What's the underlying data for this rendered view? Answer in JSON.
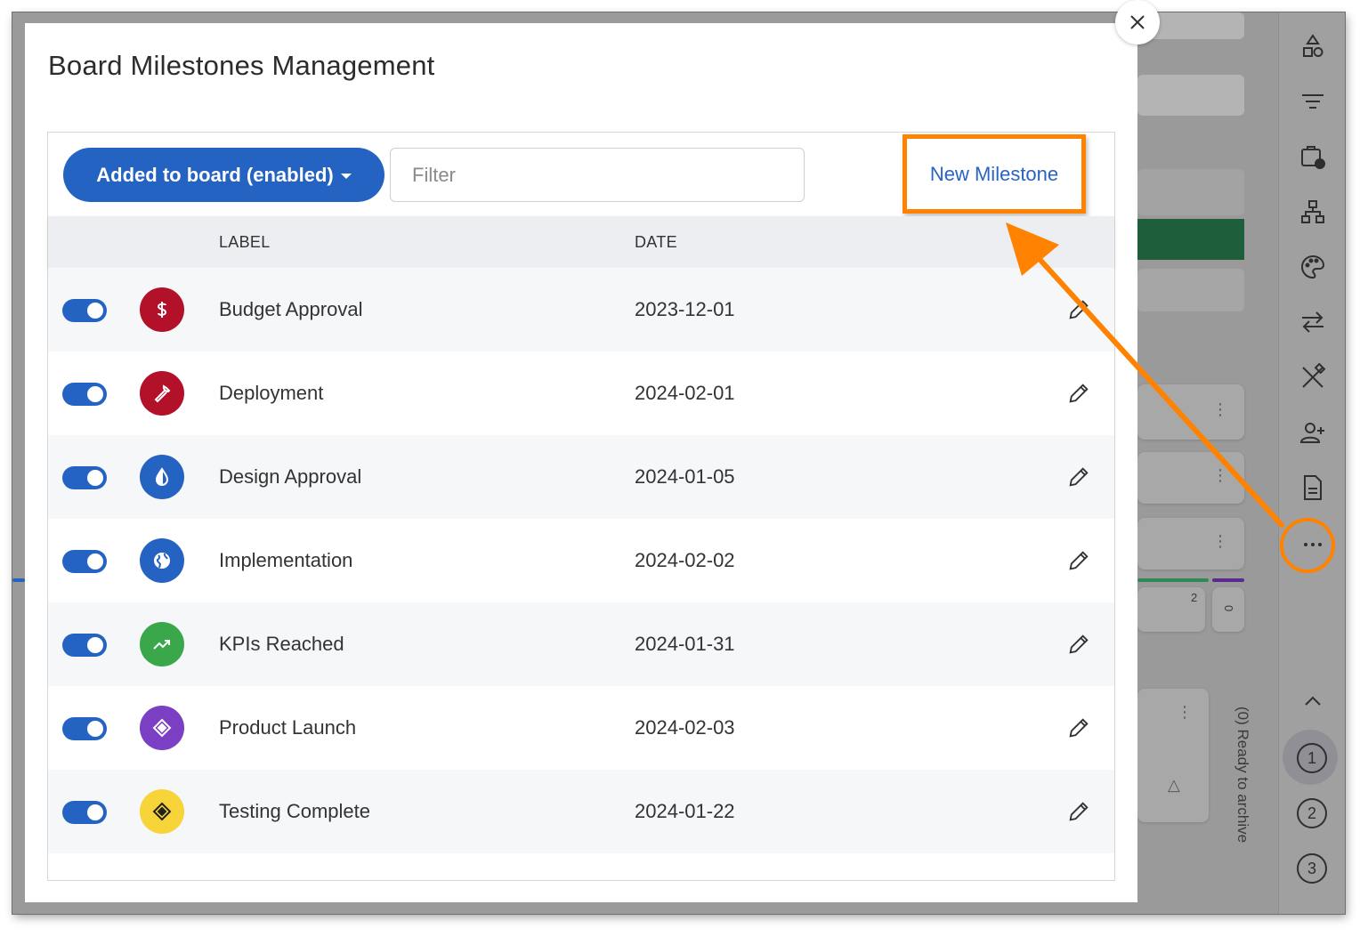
{
  "modal": {
    "title": "Board Milestones Management",
    "close_icon": "close-icon"
  },
  "toolbar": {
    "filter_dropdown_label": "Added to board (enabled)",
    "filter_placeholder": "Filter",
    "new_milestone_label": "New Milestone"
  },
  "table": {
    "columns": [
      "LABEL",
      "DATE"
    ],
    "rows": [
      {
        "label": "Budget Approval",
        "date": "2023-12-01",
        "enabled": true,
        "icon": "dollar-icon",
        "color": "#b3102a"
      },
      {
        "label": "Deployment",
        "date": "2024-02-01",
        "enabled": true,
        "icon": "wrench-icon",
        "color": "#b3102a"
      },
      {
        "label": "Design Approval",
        "date": "2024-01-05",
        "enabled": true,
        "icon": "contrast-drop-icon",
        "color": "#2563c3"
      },
      {
        "label": "Implementation",
        "date": "2024-02-02",
        "enabled": true,
        "icon": "globe-icon",
        "color": "#2563c3"
      },
      {
        "label": "KPIs Reached",
        "date": "2024-01-31",
        "enabled": true,
        "icon": "trending-up-icon",
        "color": "#3aa84a"
      },
      {
        "label": "Product Launch",
        "date": "2024-02-03",
        "enabled": true,
        "icon": "diamond-icon",
        "color": "#7b3fc4"
      },
      {
        "label": "Testing Complete",
        "date": "2024-01-22",
        "enabled": true,
        "icon": "diamond-icon",
        "color": "#f7d43a"
      }
    ]
  },
  "background": {
    "vertical_column_label": "(0) Ready to archive",
    "badge_count": "2",
    "badge_zero": "0"
  },
  "sidebar": {
    "icons": [
      "shapes-icon",
      "filter-lines-icon",
      "clipboard-clock-icon",
      "hierarchy-icon",
      "palette-icon",
      "swap-arrows-icon",
      "tools-icon",
      "add-user-icon",
      "document-icon",
      "more-icon",
      "chevron-up-icon"
    ],
    "numbers": [
      "1",
      "2",
      "3"
    ]
  },
  "colors": {
    "primary": "#2563c3",
    "highlight": "#ff8200"
  }
}
